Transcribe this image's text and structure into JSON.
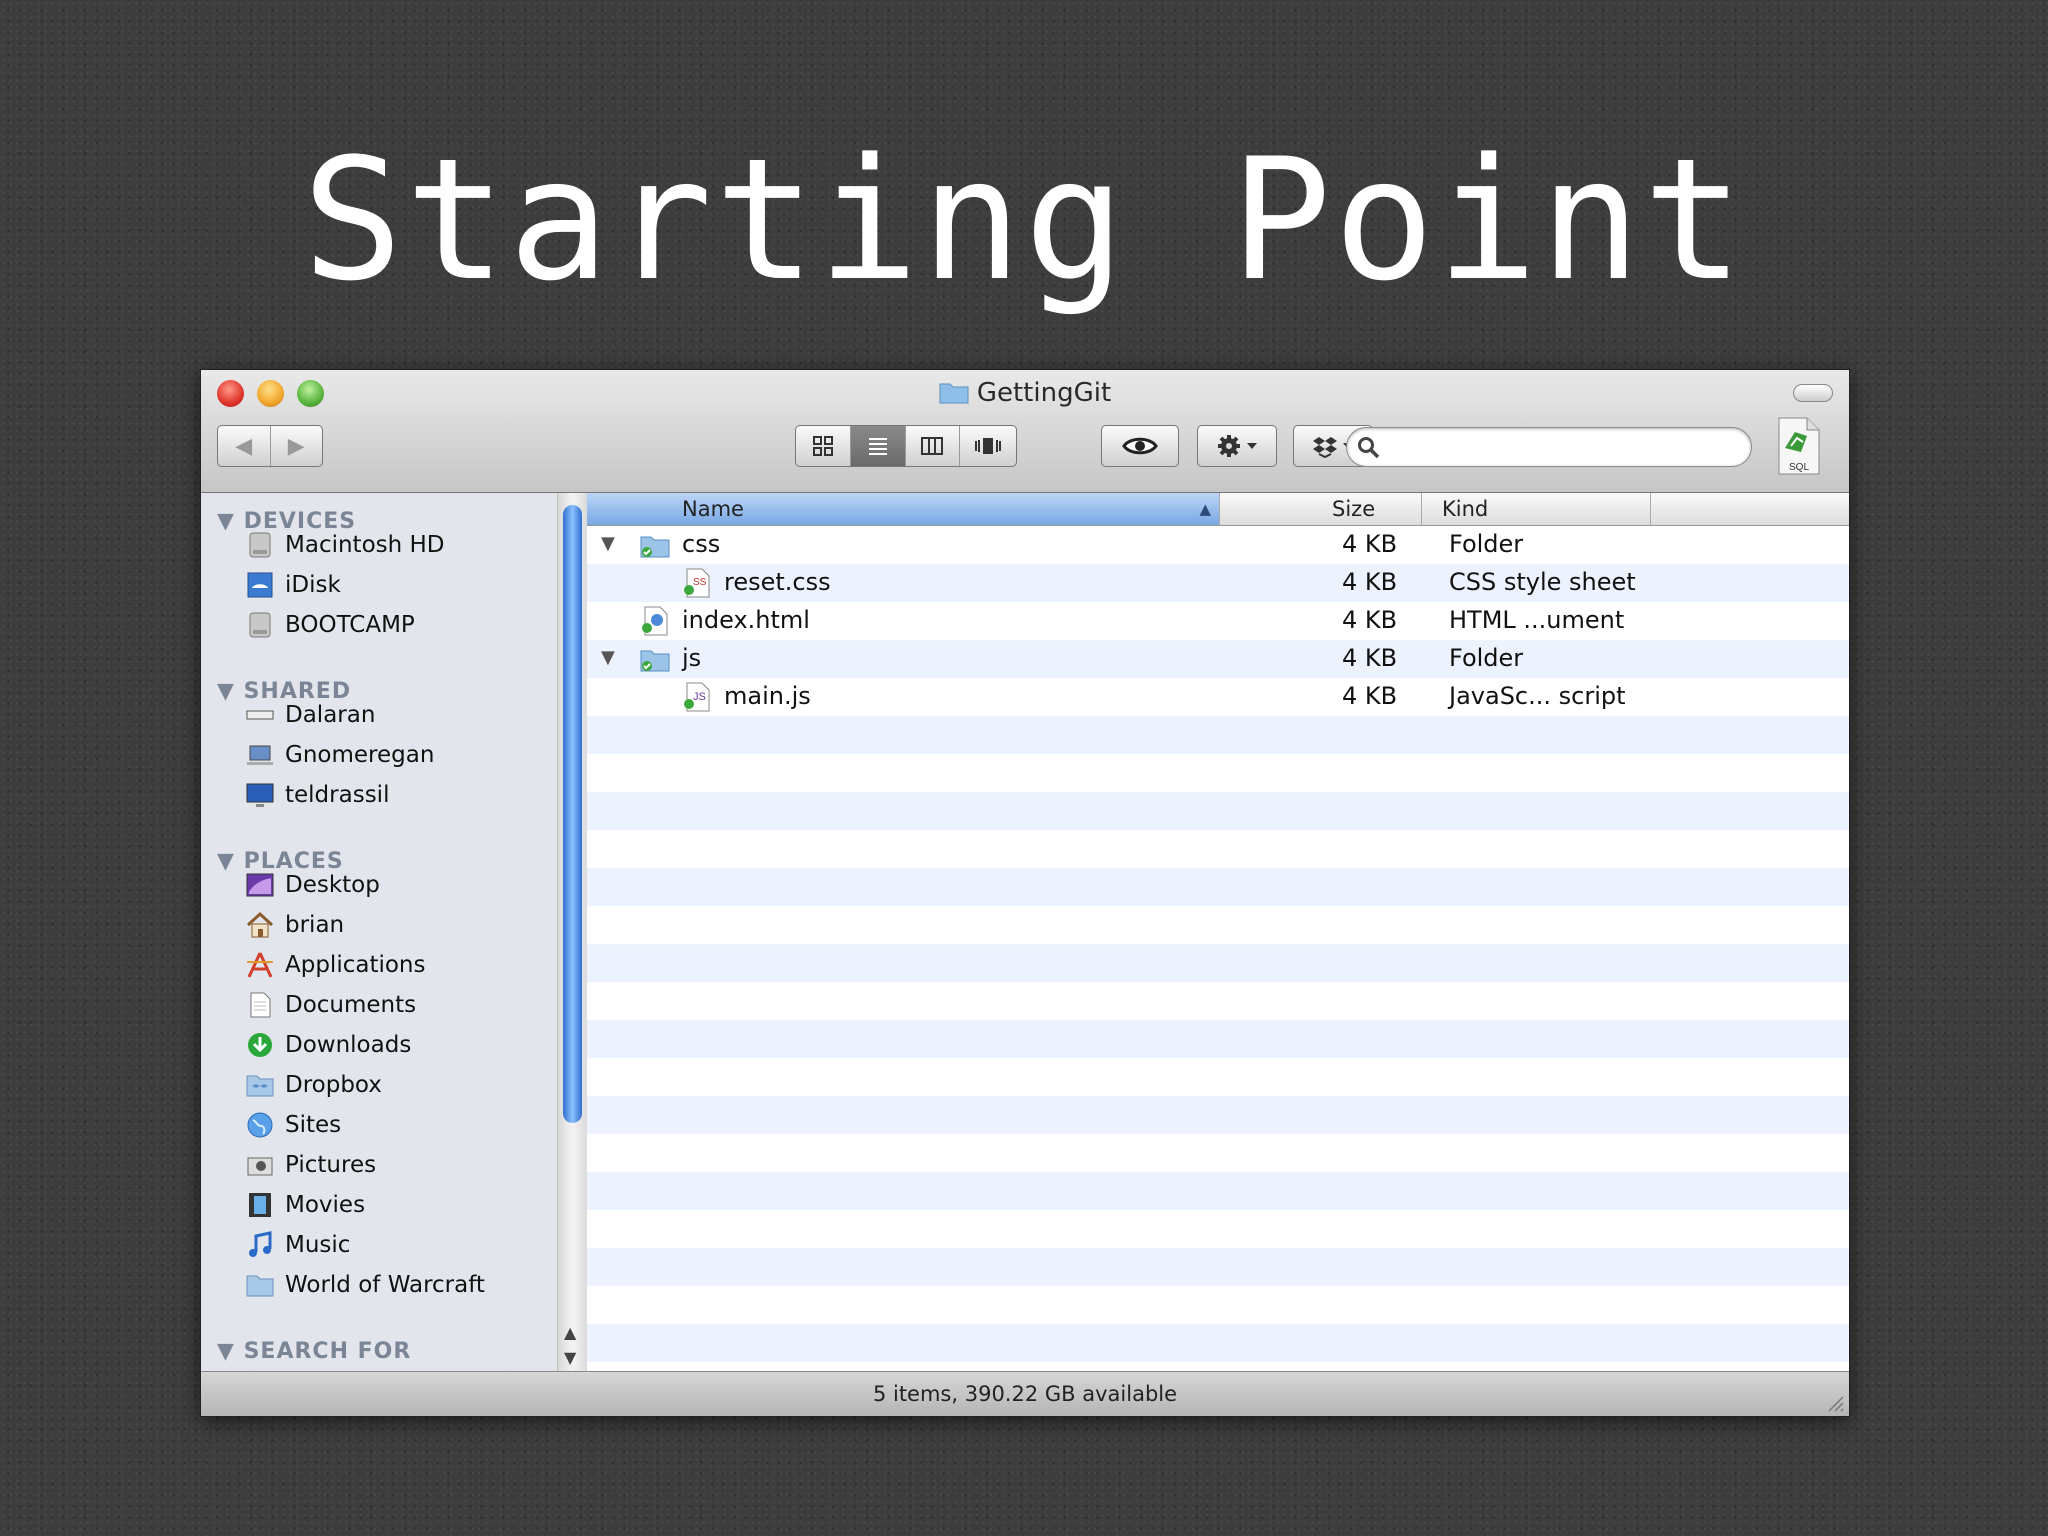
{
  "slide": {
    "title": "Starting Point"
  },
  "window": {
    "title": "GettingGit",
    "search_placeholder": "",
    "status": "5 items, 390.22 GB available"
  },
  "toolbar": {
    "nav": [
      "◀",
      "▶"
    ],
    "view_modes": [
      "icon-view-icon",
      "list-view-icon",
      "column-view-icon",
      "cover-flow-icon"
    ],
    "active_view": "list-view-icon"
  },
  "sidebar": {
    "devices_label": "DEVICES",
    "devices": [
      {
        "label": "Macintosh HD",
        "icon": "hard-drive-icon"
      },
      {
        "label": "iDisk",
        "icon": "idisk-icon"
      },
      {
        "label": "BOOTCAMP",
        "icon": "hard-drive-icon"
      }
    ],
    "shared_label": "SHARED",
    "shared": [
      {
        "label": "Dalaran",
        "icon": "server-icon"
      },
      {
        "label": "Gnomeregan",
        "icon": "laptop-icon"
      },
      {
        "label": "teldrassil",
        "icon": "monitor-icon"
      }
    ],
    "places_label": "PLACES",
    "places": [
      {
        "label": "Desktop",
        "icon": "desktop-icon"
      },
      {
        "label": "brian",
        "icon": "home-icon"
      },
      {
        "label": "Applications",
        "icon": "applications-icon"
      },
      {
        "label": "Documents",
        "icon": "documents-icon"
      },
      {
        "label": "Downloads",
        "icon": "downloads-icon"
      },
      {
        "label": "Dropbox",
        "icon": "dropbox-folder-icon"
      },
      {
        "label": "Sites",
        "icon": "globe-icon"
      },
      {
        "label": "Pictures",
        "icon": "camera-icon"
      },
      {
        "label": "Movies",
        "icon": "film-icon"
      },
      {
        "label": "Music",
        "icon": "music-note-icon"
      },
      {
        "label": "World of Warcraft",
        "icon": "folder-icon"
      }
    ],
    "search_label": "SEARCH FOR"
  },
  "columns": {
    "name": "Name",
    "size": "Size",
    "kind": "Kind"
  },
  "files": [
    {
      "name": "css",
      "size": "4 KB",
      "kind": "Folder",
      "type": "folder",
      "indent": 0,
      "expanded": true
    },
    {
      "name": "reset.css",
      "size": "4 KB",
      "kind": "CSS style sheet",
      "type": "css",
      "indent": 1
    },
    {
      "name": "index.html",
      "size": "4 KB",
      "kind": "HTML ...ument",
      "type": "html",
      "indent": 0
    },
    {
      "name": "js",
      "size": "4 KB",
      "kind": "Folder",
      "type": "folder",
      "indent": 0,
      "expanded": true
    },
    {
      "name": "main.js",
      "size": "4 KB",
      "kind": "JavaSc... script",
      "type": "js",
      "indent": 1
    }
  ]
}
